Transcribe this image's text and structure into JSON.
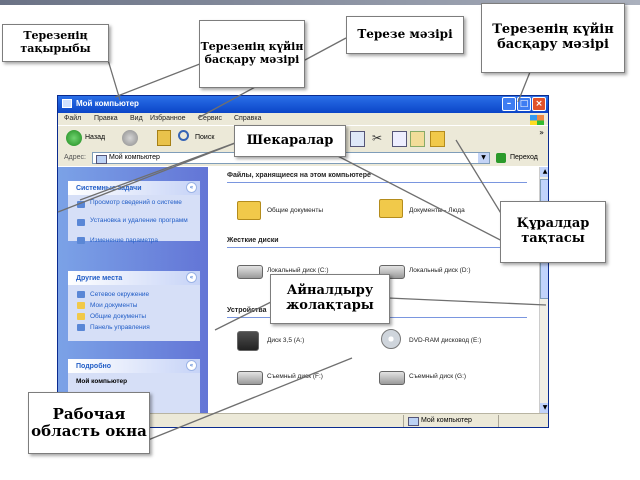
{
  "window": {
    "title": "Мой компьютер",
    "menu": [
      "Файл",
      "Правка",
      "Вид",
      "Избранное",
      "Сервис",
      "Справка"
    ],
    "toolbar": {
      "back_label": "Назад",
      "search_label": "Поиск"
    },
    "address": {
      "label": "Адрес:",
      "value": "Мой компьютер",
      "go_label": "Переход"
    },
    "side_panels": [
      {
        "title": "Системные задачи",
        "items": [
          "Просмотр сведений о системе",
          "Установка и удаление программ",
          "Изменение параметра"
        ]
      },
      {
        "title": "Другие места",
        "items": [
          "Сетевое окружение",
          "Мои документы",
          "Общие документы",
          "Панель управления"
        ]
      },
      {
        "title": "Подробно",
        "items": [
          "Мой компьютер"
        ]
      }
    ],
    "groups": {
      "files": {
        "title": "Файлы, хранящиеся на этом компьютере",
        "items": [
          "Общие документы",
          "Документы - Люда"
        ]
      },
      "hdd": {
        "title": "Жесткие диски",
        "items": [
          "Локальный диск (C:)",
          "Локальный диск (D:)"
        ]
      },
      "removable": {
        "title": "Устройства",
        "items": [
          "Диск 3,5 (A:)",
          "DVD-RAM дисковод (E:)",
          "Съемный диск (F:)",
          "Съемный диск (G:)"
        ]
      }
    },
    "status_text": "Мой компьютер"
  },
  "callouts": {
    "title": "Терезенің тақырыбы",
    "control_menu_left": "Терезенің күйін басқару мәзірі",
    "menu": "Терезе мәзірі",
    "control_menu_right": "Терезенің күйін басқару мәзірі",
    "borders": "Шекаралар",
    "toolbar": "Құралдар тақтасы",
    "scrollbars": "Айналдыру жолақтары",
    "workarea": "Рабочая область окна"
  }
}
